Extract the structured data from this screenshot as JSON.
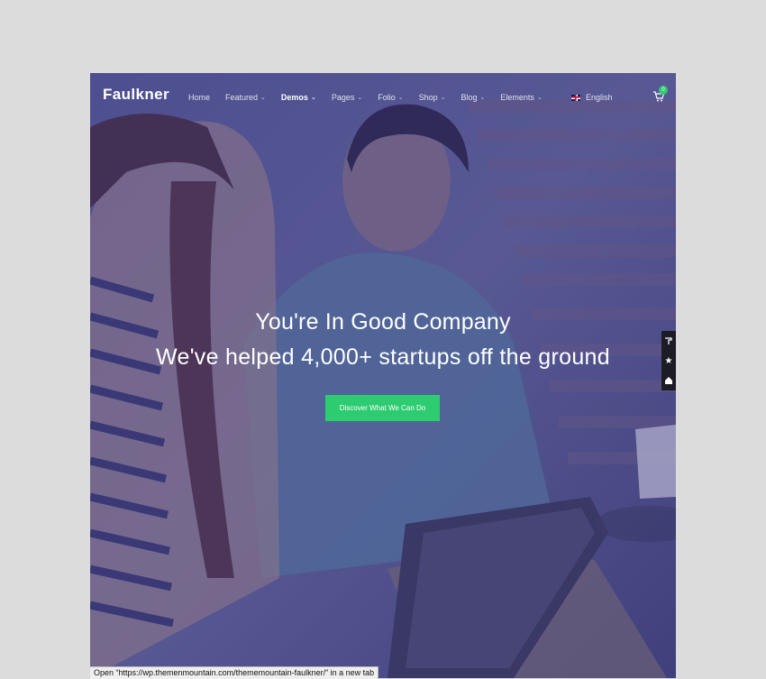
{
  "site": {
    "logo": "Faulkner",
    "nav": [
      {
        "label": "Home",
        "has_dropdown": false,
        "active": false
      },
      {
        "label": "Featured",
        "has_dropdown": true,
        "active": false
      },
      {
        "label": "Demos",
        "has_dropdown": true,
        "active": true
      },
      {
        "label": "Pages",
        "has_dropdown": true,
        "active": false
      },
      {
        "label": "Folio",
        "has_dropdown": true,
        "active": false
      },
      {
        "label": "Shop",
        "has_dropdown": true,
        "active": false
      },
      {
        "label": "Blog",
        "has_dropdown": true,
        "active": false
      },
      {
        "label": "Elements",
        "has_dropdown": true,
        "active": false
      }
    ],
    "language": "English",
    "cart_count": "0"
  },
  "hero": {
    "subtitle": "You're In Good Company",
    "title": "We've helped 4,000+ startups off the ground",
    "cta_label": "Discover What We Can Do"
  },
  "status_bar": {
    "text": "Open “https://wp.themenmountain.com/thememountain-faulkner/” in a new tab"
  },
  "colors": {
    "accent": "#2ecc71",
    "overlay": "#3a3480",
    "page_bg": "#dcdcdc"
  },
  "icons": [
    "cart-icon",
    "chevron-down-icon",
    "uk-flag-icon",
    "paint-roller-icon",
    "star-icon",
    "home-icon"
  ]
}
